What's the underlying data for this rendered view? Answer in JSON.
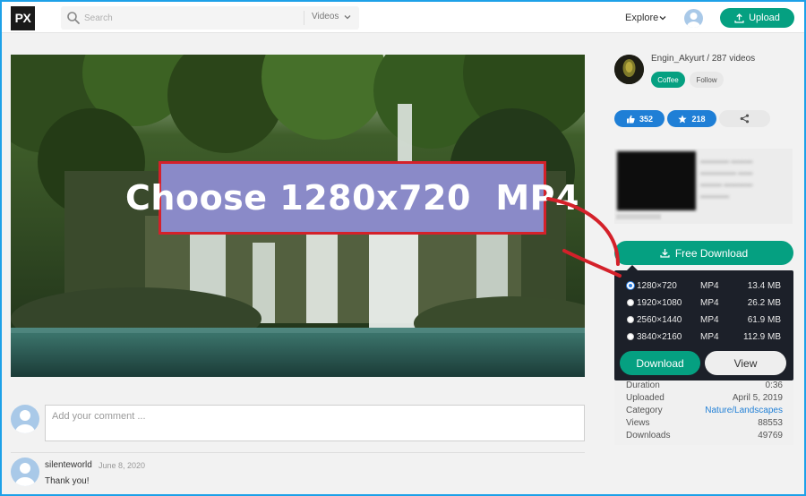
{
  "header": {
    "logo": "PX",
    "search_placeholder": "Search",
    "search_scope": "Videos",
    "explore": "Explore",
    "upload": "Upload"
  },
  "video": {
    "callout": "Choose 1280x720  MP4"
  },
  "comments": {
    "placeholder": "Add your comment ...",
    "items": [
      {
        "user": "silenteworld",
        "date": "June 8, 2020",
        "text": "Thank you!"
      }
    ]
  },
  "author": {
    "line": "Engin_Akyurt / 287 videos",
    "tag": "Coffee",
    "follow": "Follow"
  },
  "stats": {
    "likes": "352",
    "stars": "218"
  },
  "download": {
    "free_label": "Free Download",
    "options": [
      {
        "resolution": "1280×720",
        "format": "MP4",
        "size": "13.4 MB",
        "selected": true
      },
      {
        "resolution": "1920×1080",
        "format": "MP4",
        "size": "26.2 MB",
        "selected": false
      },
      {
        "resolution": "2560×1440",
        "format": "MP4",
        "size": "61.9 MB",
        "selected": false
      },
      {
        "resolution": "3840×2160",
        "format": "MP4",
        "size": "112.9 MB",
        "selected": false
      }
    ],
    "download_label": "Download",
    "view_label": "View"
  },
  "details": [
    {
      "key": "Duration",
      "value": "0:36"
    },
    {
      "key": "Uploaded",
      "value": "April 5, 2019"
    },
    {
      "key": "Category",
      "value": "Nature/Landscapes"
    },
    {
      "key": "Views",
      "value": "88553"
    },
    {
      "key": "Downloads",
      "value": "49769"
    }
  ],
  "colors": {
    "brand_green": "#05a081",
    "accent_blue": "#1f7fd6",
    "callout_fill": "#8a8ac8",
    "callout_border": "#d4212a",
    "panel_dark": "#1c2029"
  }
}
